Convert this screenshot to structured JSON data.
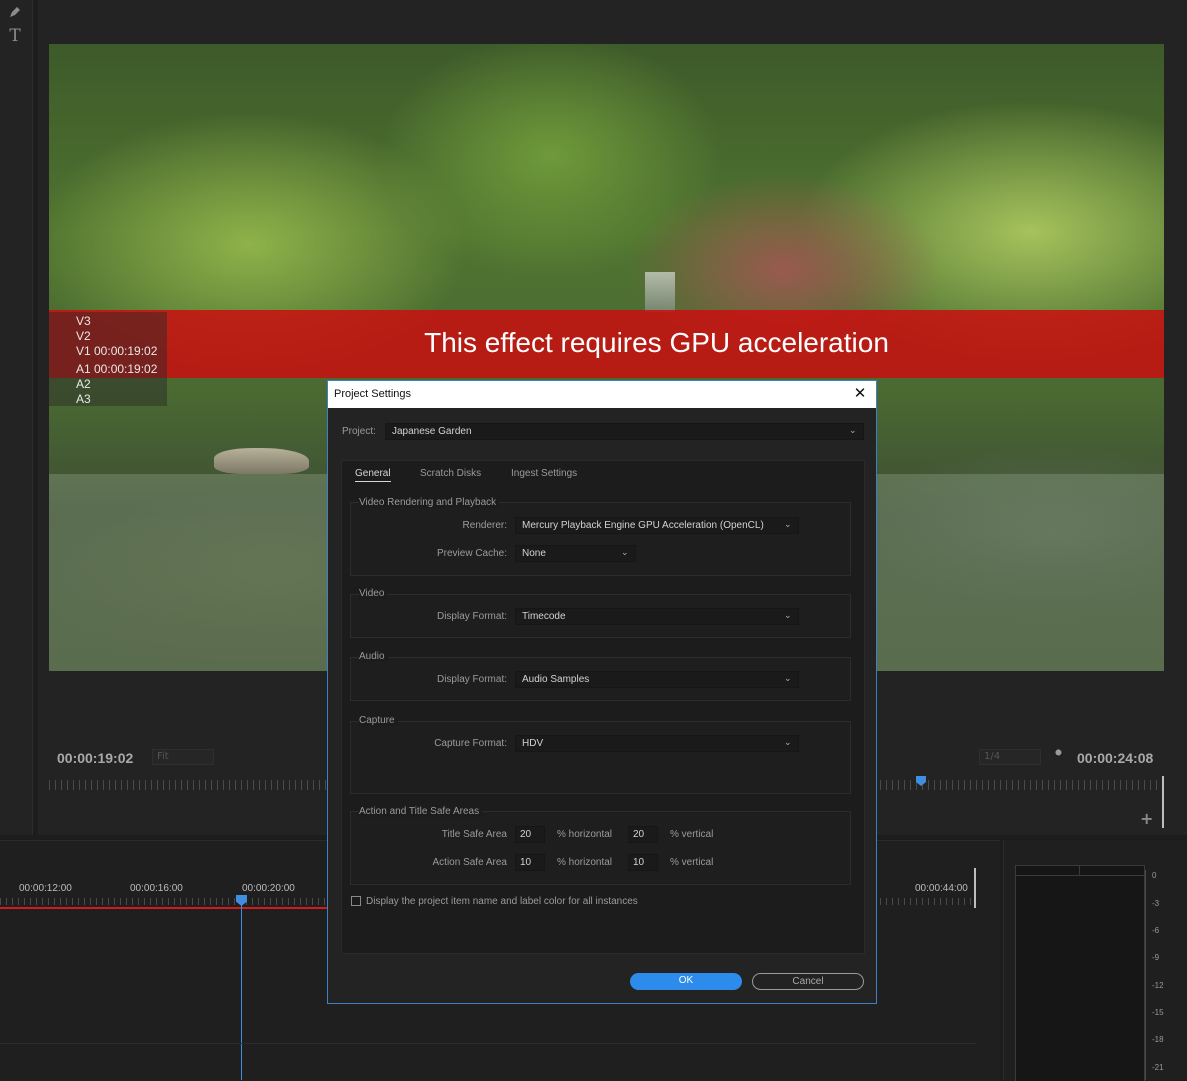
{
  "tools": {
    "pen_icon": "pen-icon",
    "type_icon": "type-tool-icon",
    "type_glyph": "T"
  },
  "monitor": {
    "banner_text": "This effect requires GPU acceleration",
    "track_overlay": [
      "V3",
      "V2",
      "V1 00:00:19:02",
      "A1 00:00:19:02",
      "A2",
      "A3"
    ],
    "timecode_left": "00:00:19:02",
    "zoom_value": "Fit",
    "resolution_value": "1/4",
    "timecode_right": "00:00:24:08",
    "add_glyph": "+"
  },
  "timeline": {
    "times": [
      "00:00:12:00",
      "00:00:16:00",
      "00:00:20:00",
      "00:00:44:00"
    ]
  },
  "meter": {
    "db_labels": [
      "0",
      "-3",
      "-6",
      "-9",
      "-12",
      "-15",
      "-18",
      "-21"
    ]
  },
  "dialog": {
    "title": "Project Settings",
    "close_glyph": "✕",
    "project_label": "Project:",
    "project_value": "Japanese Garden",
    "tabs": [
      "General",
      "Scratch Disks",
      "Ingest Settings"
    ],
    "video_rendering": {
      "heading": "Video Rendering and Playback",
      "renderer_label": "Renderer:",
      "renderer_value": "Mercury Playback Engine GPU Acceleration (OpenCL)",
      "preview_cache_label": "Preview Cache:",
      "preview_cache_value": "None"
    },
    "video": {
      "heading": "Video",
      "display_format_label": "Display Format:",
      "display_format_value": "Timecode"
    },
    "audio": {
      "heading": "Audio",
      "display_format_label": "Display Format:",
      "display_format_value": "Audio Samples"
    },
    "capture": {
      "heading": "Capture",
      "capture_format_label": "Capture Format:",
      "capture_format_value": "HDV"
    },
    "safe_areas": {
      "heading": "Action and Title Safe Areas",
      "title_label": "Title Safe Area",
      "title_h": "20",
      "title_v": "20",
      "action_label": "Action Safe Area",
      "action_h": "10",
      "action_v": "10",
      "horizontal_label": "% horizontal",
      "vertical_label": "% vertical"
    },
    "checkbox_label": "Display the project item name and label color for all instances",
    "ok_label": "OK",
    "cancel_label": "Cancel"
  },
  "colors": {
    "accent": "#2d8ceb",
    "banner": "#c80f0f",
    "playhead": "#3f8ee0"
  }
}
